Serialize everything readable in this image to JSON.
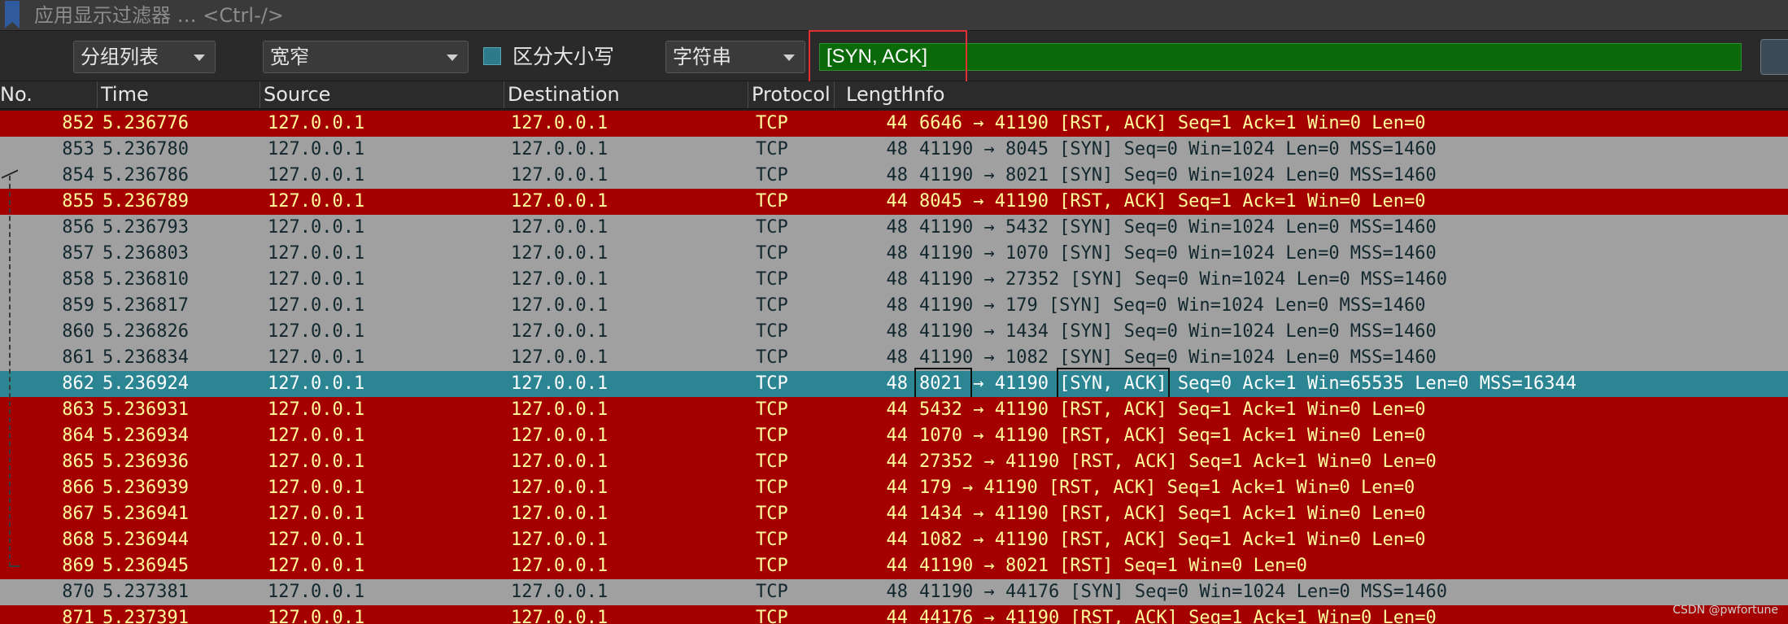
{
  "filter_bar": {
    "placeholder": "应用显示过滤器 … <Ctrl-/>"
  },
  "find_bar": {
    "search_in": "分组列表",
    "char_width": "宽窄",
    "case_sensitive_label": "区分大小写",
    "case_sensitive": true,
    "search_type": "字符串",
    "search_value": "[SYN, ACK]"
  },
  "columns": {
    "no": "No.",
    "time": "Time",
    "source": "Source",
    "destination": "Destination",
    "protocol": "Protocol",
    "length": "Length",
    "info": "Info"
  },
  "packets": [
    {
      "no": "852",
      "time": "5.236776",
      "src": "127.0.0.1",
      "dst": "127.0.0.1",
      "proto": "TCP",
      "len": "44",
      "info": "6646 → 41190 [RST, ACK] Seq=1 Ack=1 Win=0 Len=0",
      "kind": "rst"
    },
    {
      "no": "853",
      "time": "5.236780",
      "src": "127.0.0.1",
      "dst": "127.0.0.1",
      "proto": "TCP",
      "len": "48",
      "info": "41190 → 8045 [SYN] Seq=0 Win=1024 Len=0 MSS=1460",
      "kind": "syn"
    },
    {
      "no": "854",
      "time": "5.236786",
      "src": "127.0.0.1",
      "dst": "127.0.0.1",
      "proto": "TCP",
      "len": "48",
      "info": "41190 → 8021 [SYN] Seq=0 Win=1024 Len=0 MSS=1460",
      "kind": "syn"
    },
    {
      "no": "855",
      "time": "5.236789",
      "src": "127.0.0.1",
      "dst": "127.0.0.1",
      "proto": "TCP",
      "len": "44",
      "info": "8045 → 41190 [RST, ACK] Seq=1 Ack=1 Win=0 Len=0",
      "kind": "rst"
    },
    {
      "no": "856",
      "time": "5.236793",
      "src": "127.0.0.1",
      "dst": "127.0.0.1",
      "proto": "TCP",
      "len": "48",
      "info": "41190 → 5432 [SYN] Seq=0 Win=1024 Len=0 MSS=1460",
      "kind": "syn"
    },
    {
      "no": "857",
      "time": "5.236803",
      "src": "127.0.0.1",
      "dst": "127.0.0.1",
      "proto": "TCP",
      "len": "48",
      "info": "41190 → 1070 [SYN] Seq=0 Win=1024 Len=0 MSS=1460",
      "kind": "syn"
    },
    {
      "no": "858",
      "time": "5.236810",
      "src": "127.0.0.1",
      "dst": "127.0.0.1",
      "proto": "TCP",
      "len": "48",
      "info": "41190 → 27352 [SYN] Seq=0 Win=1024 Len=0 MSS=1460",
      "kind": "syn"
    },
    {
      "no": "859",
      "time": "5.236817",
      "src": "127.0.0.1",
      "dst": "127.0.0.1",
      "proto": "TCP",
      "len": "48",
      "info": "41190 → 179 [SYN] Seq=0 Win=1024 Len=0 MSS=1460",
      "kind": "syn"
    },
    {
      "no": "860",
      "time": "5.236826",
      "src": "127.0.0.1",
      "dst": "127.0.0.1",
      "proto": "TCP",
      "len": "48",
      "info": "41190 → 1434 [SYN] Seq=0 Win=1024 Len=0 MSS=1460",
      "kind": "syn"
    },
    {
      "no": "861",
      "time": "5.236834",
      "src": "127.0.0.1",
      "dst": "127.0.0.1",
      "proto": "TCP",
      "len": "48",
      "info": "41190 → 1082 [SYN] Seq=0 Win=1024 Len=0 MSS=1460",
      "kind": "syn"
    },
    {
      "no": "862",
      "time": "5.236924",
      "src": "127.0.0.1",
      "dst": "127.0.0.1",
      "proto": "TCP",
      "len": "48",
      "info": "8021 → 41190 [SYN, ACK] Seq=0 Ack=1 Win=65535 Len=0 MSS=16344",
      "kind": "sel"
    },
    {
      "no": "863",
      "time": "5.236931",
      "src": "127.0.0.1",
      "dst": "127.0.0.1",
      "proto": "TCP",
      "len": "44",
      "info": "5432 → 41190 [RST, ACK] Seq=1 Ack=1 Win=0 Len=0",
      "kind": "rst"
    },
    {
      "no": "864",
      "time": "5.236934",
      "src": "127.0.0.1",
      "dst": "127.0.0.1",
      "proto": "TCP",
      "len": "44",
      "info": "1070 → 41190 [RST, ACK] Seq=1 Ack=1 Win=0 Len=0",
      "kind": "rst"
    },
    {
      "no": "865",
      "time": "5.236936",
      "src": "127.0.0.1",
      "dst": "127.0.0.1",
      "proto": "TCP",
      "len": "44",
      "info": "27352 → 41190 [RST, ACK] Seq=1 Ack=1 Win=0 Len=0",
      "kind": "rst"
    },
    {
      "no": "866",
      "time": "5.236939",
      "src": "127.0.0.1",
      "dst": "127.0.0.1",
      "proto": "TCP",
      "len": "44",
      "info": "179 → 41190 [RST, ACK] Seq=1 Ack=1 Win=0 Len=0",
      "kind": "rst"
    },
    {
      "no": "867",
      "time": "5.236941",
      "src": "127.0.0.1",
      "dst": "127.0.0.1",
      "proto": "TCP",
      "len": "44",
      "info": "1434 → 41190 [RST, ACK] Seq=1 Ack=1 Win=0 Len=0",
      "kind": "rst"
    },
    {
      "no": "868",
      "time": "5.236944",
      "src": "127.0.0.1",
      "dst": "127.0.0.1",
      "proto": "TCP",
      "len": "44",
      "info": "1082 → 41190 [RST, ACK] Seq=1 Ack=1 Win=0 Len=0",
      "kind": "rst"
    },
    {
      "no": "869",
      "time": "5.236945",
      "src": "127.0.0.1",
      "dst": "127.0.0.1",
      "proto": "TCP",
      "len": "44",
      "info": "41190 → 8021 [RST] Seq=1 Win=0 Len=0",
      "kind": "rst"
    },
    {
      "no": "870",
      "time": "5.237381",
      "src": "127.0.0.1",
      "dst": "127.0.0.1",
      "proto": "TCP",
      "len": "48",
      "info": "41190 → 44176 [SYN] Seq=0 Win=1024 Len=0 MSS=1460",
      "kind": "syn"
    },
    {
      "no": "871",
      "time": "5.237391",
      "src": "127.0.0.1",
      "dst": "127.0.0.1",
      "proto": "TCP",
      "len": "44",
      "info": "44176 → 41190 [RST, ACK] Seq=1 Ack=1 Win=0 Len=0",
      "kind": "rst"
    }
  ],
  "watermark": "CSDN @pwfortune",
  "colors": {
    "rst_row_bg": "#a40000",
    "rst_row_fg": "#fffc9c",
    "syn_row_bg": "#a0a0a0",
    "syn_row_fg": "#12272e",
    "selected_row_bg": "#2c8593",
    "search_field_bg": "#0a6a0a",
    "annotation_red": "#e33030"
  }
}
